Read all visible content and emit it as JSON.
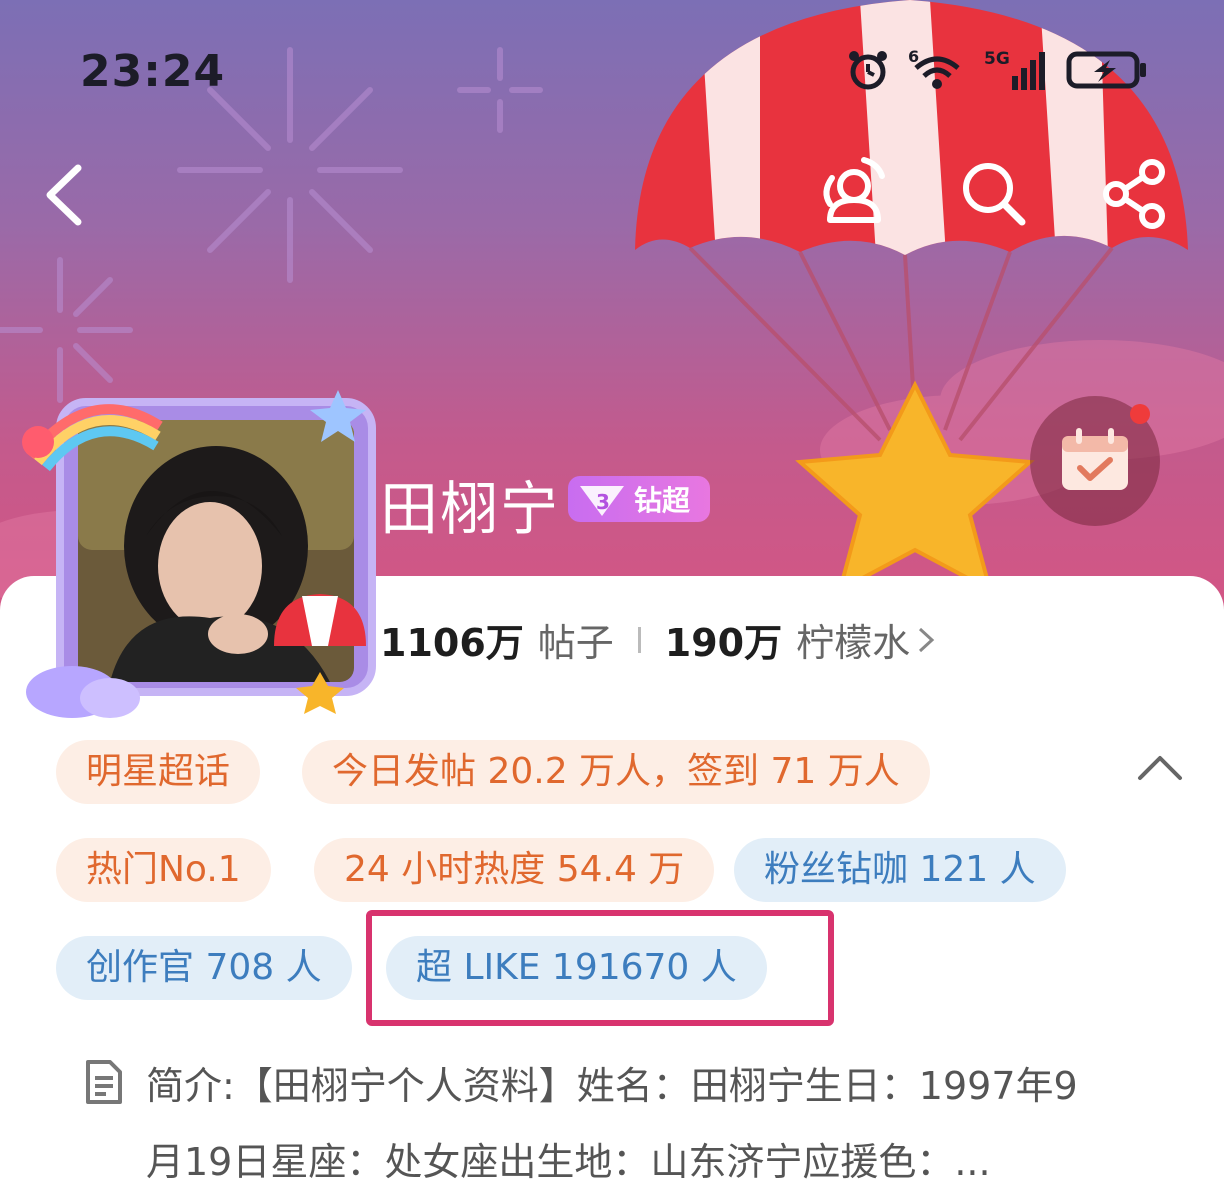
{
  "status_bar": {
    "time": "23:24",
    "icons": [
      "alarm-icon",
      "wifi-icon",
      "signal-icon",
      "battery-icon"
    ],
    "wifi_label": "6",
    "network_label": "5G"
  },
  "header": {
    "back_icon": "chevron-left-icon",
    "actions": [
      "friends-icon",
      "search-icon",
      "share-icon"
    ],
    "checkin_icon": "calendar-check-icon"
  },
  "profile": {
    "name": "田栩宁",
    "badge_label": "钻超",
    "badge_level": "3",
    "posts_count": "1106万",
    "posts_label": "帖子",
    "lemon_count": "190万",
    "lemon_label": "柠檬水"
  },
  "tags": {
    "row1": [
      "明星超话",
      "今日发帖 20.2 万人，签到 71 万人"
    ],
    "row2": [
      "热门No.1",
      "24 小时热度 54.4 万",
      "粉丝钻咖 121 人"
    ],
    "row3": [
      "创作官 708 人",
      "超 LIKE 191670 人"
    ]
  },
  "intro": {
    "text": "简介:【田栩宁个人资料】姓名：田栩宁生日：1997年9月19日星座：处女座出生地：山东济宁应援色：..."
  },
  "colors": {
    "tag_orange_bg": "#fdeee5",
    "tag_orange_text": "#e0682e",
    "tag_blue_bg": "#e2eef8",
    "tag_blue_text": "#3d7dbe",
    "highlight": "#d8336e"
  }
}
